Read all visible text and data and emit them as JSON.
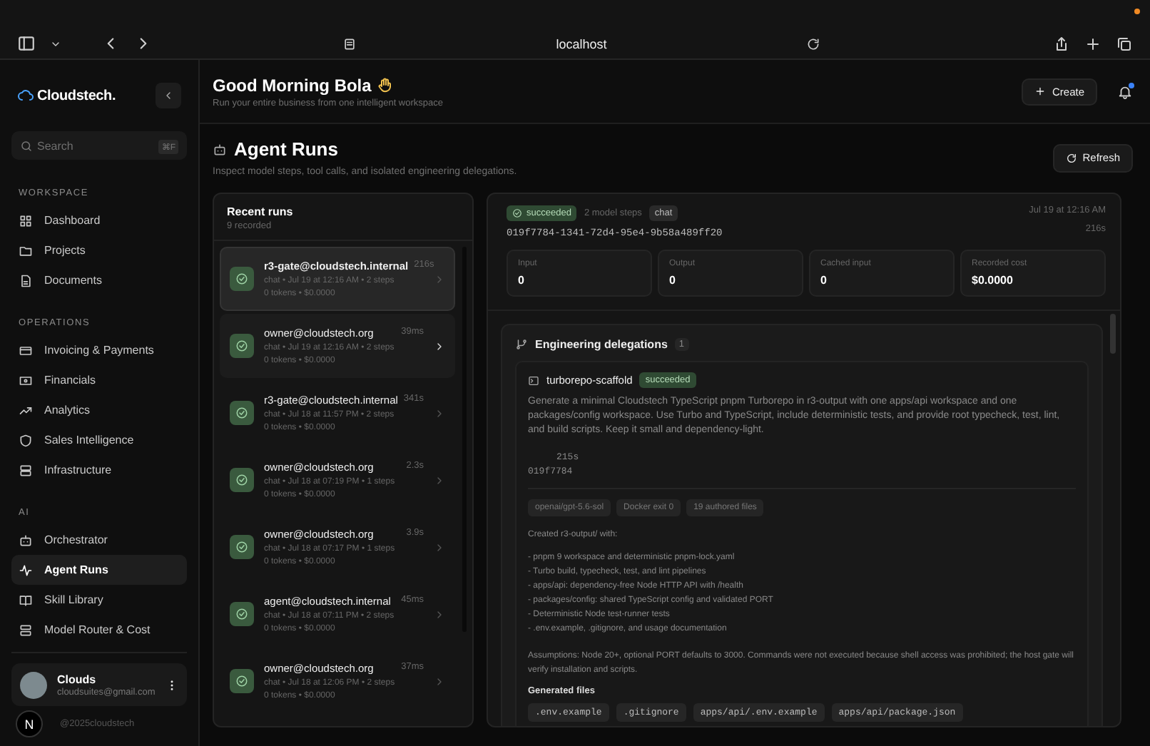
{
  "browser": {
    "address": "localhost"
  },
  "sidebar": {
    "logo": "Cloudstech.",
    "search": {
      "placeholder": "Search",
      "shortcut": "⌘F"
    },
    "sections": [
      {
        "title": "WORKSPACE",
        "items": [
          {
            "label": "Dashboard",
            "selected": false
          },
          {
            "label": "Projects",
            "selected": false
          },
          {
            "label": "Documents",
            "selected": false
          }
        ]
      },
      {
        "title": "OPERATIONS",
        "items": [
          {
            "label": "Invoicing & Payments",
            "selected": false
          },
          {
            "label": "Financials",
            "selected": false
          },
          {
            "label": "Analytics",
            "selected": false
          },
          {
            "label": "Sales Intelligence",
            "selected": false
          },
          {
            "label": "Infrastructure",
            "selected": false
          }
        ]
      },
      {
        "title": "AI",
        "items": [
          {
            "label": "Orchestrator",
            "selected": false
          },
          {
            "label": "Agent Runs",
            "selected": true
          },
          {
            "label": "Skill Library",
            "selected": false
          },
          {
            "label": "Model Router & Cost",
            "selected": false
          }
        ]
      }
    ],
    "user": {
      "name": "Clouds",
      "email": "cloudsuites@gmail.com"
    },
    "badge": "N",
    "footer": "@2025cloudstech"
  },
  "header": {
    "greeting": "Good Morning Bola",
    "subtitle": "Run your entire business from one intelligent workspace",
    "create": "Create"
  },
  "page": {
    "title": "Agent Runs",
    "subtitle": "Inspect model steps, tool calls, and isolated engineering delegations.",
    "refresh": "Refresh"
  },
  "runs": {
    "title": "Recent runs",
    "count": "9 recorded",
    "items": [
      {
        "user": "r3-gate@cloudstech.internal",
        "duration": "216s",
        "meta": "chat • Jul 19 at 12:16 AM • 2 steps",
        "usage": "0 tokens • $0.0000",
        "selected": true,
        "hovered": false
      },
      {
        "user": "owner@cloudstech.org",
        "duration": "39ms",
        "meta": "chat • Jul 19 at 12:16 AM • 2 steps",
        "usage": "0 tokens • $0.0000",
        "selected": false,
        "hovered": true
      },
      {
        "user": "r3-gate@cloudstech.internal",
        "duration": "341s",
        "meta": "chat • Jul 18 at 11:57 PM • 2 steps",
        "usage": "0 tokens • $0.0000",
        "selected": false,
        "hovered": false
      },
      {
        "user": "owner@cloudstech.org",
        "duration": "2.3s",
        "meta": "chat • Jul 18 at 07:19 PM • 1 steps",
        "usage": "0 tokens • $0.0000",
        "selected": false,
        "hovered": false
      },
      {
        "user": "owner@cloudstech.org",
        "duration": "3.9s",
        "meta": "chat • Jul 18 at 07:17 PM • 1 steps",
        "usage": "0 tokens • $0.0000",
        "selected": false,
        "hovered": false
      },
      {
        "user": "agent@cloudstech.internal",
        "duration": "45ms",
        "meta": "chat • Jul 18 at 07:11 PM • 2 steps",
        "usage": "0 tokens • $0.0000",
        "selected": false,
        "hovered": false
      },
      {
        "user": "owner@cloudstech.org",
        "duration": "37ms",
        "meta": "chat • Jul 18 at 12:06 PM • 2 steps",
        "usage": "0 tokens • $0.0000",
        "selected": false,
        "hovered": false
      }
    ]
  },
  "detail": {
    "status": "succeeded",
    "steps": "2 model steps",
    "tag": "chat",
    "id": "019f7784-1341-72d4-95e4-9b58a489ff20",
    "time": "Jul 19 at 12:16 AM",
    "duration": "216s",
    "stats": [
      {
        "label": "Input",
        "value": "0"
      },
      {
        "label": "Output",
        "value": "0"
      },
      {
        "label": "Cached input",
        "value": "0"
      },
      {
        "label": "Recorded cost",
        "value": "$0.0000"
      }
    ],
    "delegations": {
      "title": "Engineering delegations",
      "count": "1",
      "task": {
        "name": "turborepo-scaffold",
        "status": "succeeded",
        "prompt": "Generate a minimal Cloudstech TypeScript pnpm Turborepo in r3-output with one apps/api workspace and one packages/config workspace. Use Turbo and TypeScript, include deterministic tests, and provide root typecheck, test, lint, and build scripts. Keep it small and dependency-light.",
        "duration": "215s",
        "id": "019f7784",
        "tags": [
          "openai/gpt-5.6-sol",
          "Docker exit 0",
          "19 authored files"
        ],
        "intro": "Created r3-output/ with:",
        "bullets": [
          "- pnpm 9 workspace and deterministic pnpm-lock.yaml",
          "- Turbo build, typecheck, test, and lint pipelines",
          "- apps/api: dependency-free Node HTTP API with /health",
          "- packages/config: shared TypeScript config and validated PORT",
          "- Deterministic Node test-runner tests",
          "- .env.example, .gitignore, and usage documentation"
        ],
        "assumptions": "Assumptions: Node 20+, optional PORT defaults to 3000. Commands were not executed because shell access was prohibited; the host gate will verify installation and scripts.",
        "files_title": "Generated files",
        "files": [
          ".env.example",
          ".gitignore",
          "apps/api/.env.example",
          "apps/api/package.json"
        ]
      }
    }
  }
}
